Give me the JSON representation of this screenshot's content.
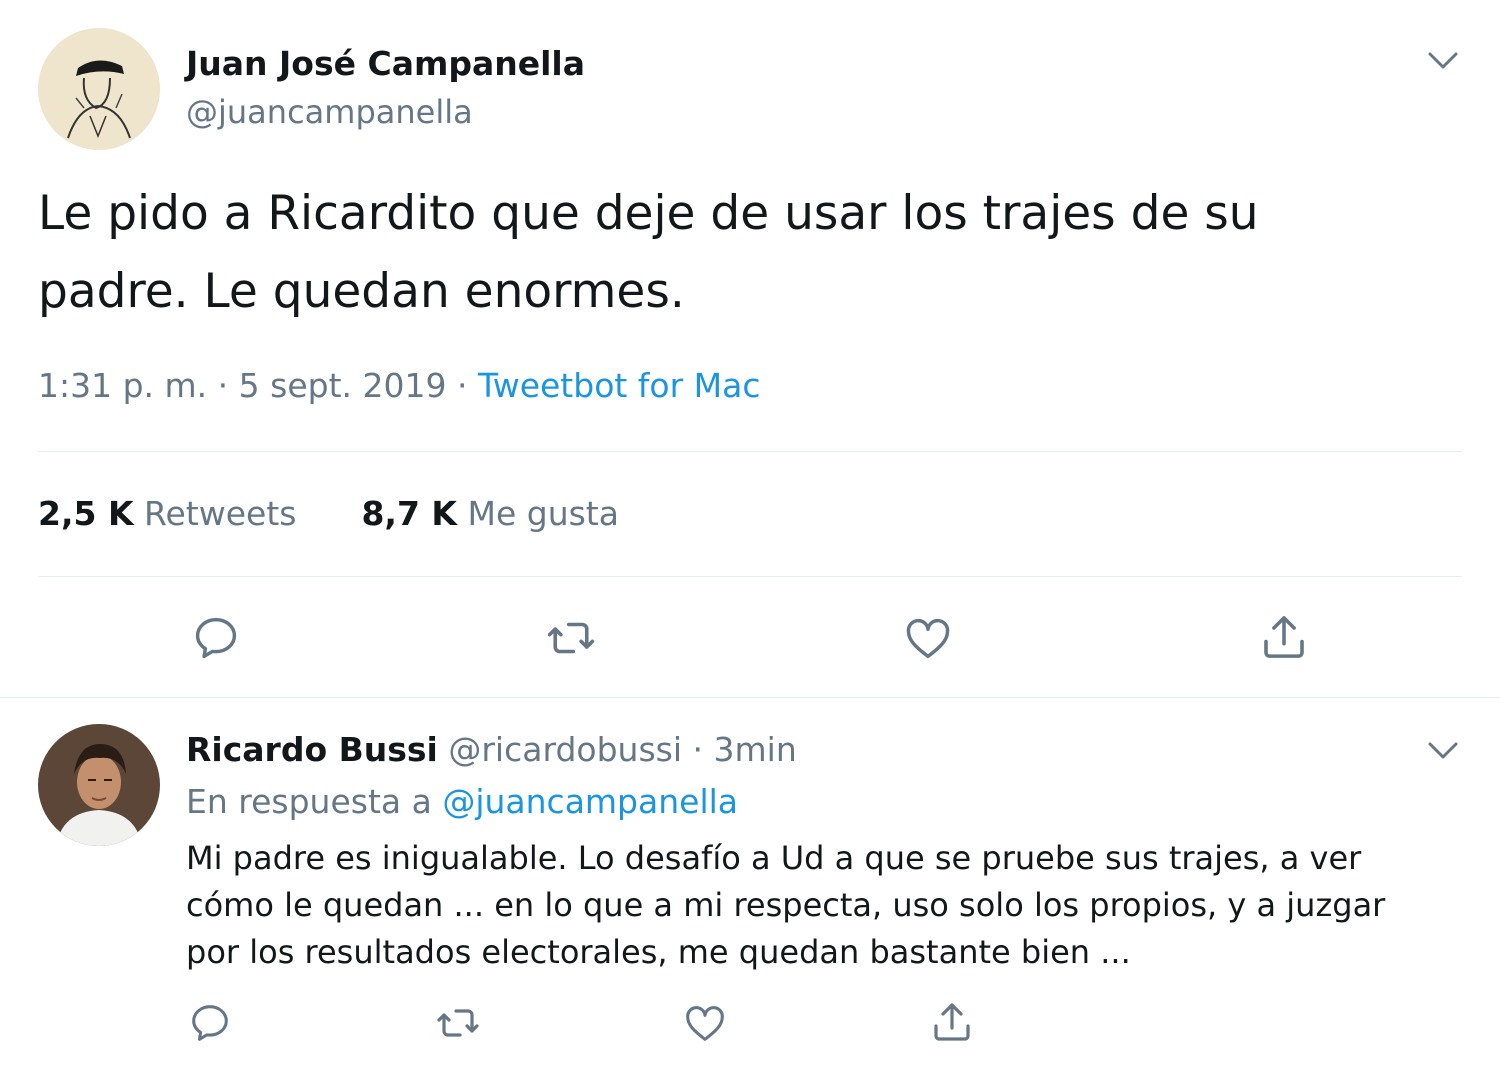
{
  "main_tweet": {
    "author_name": "Juan José Campanella",
    "author_handle": "@juancampanella",
    "text_line1": "Le pido a Ricardito que deje de usar los trajes de su",
    "text_line2": "padre. Le quedan enormes.",
    "time": "1:31 p. m.",
    "sep1": "·",
    "date": "5 sept. 2019",
    "sep2": "·",
    "source": "Tweetbot for Mac",
    "retweets_count": "2,5 K",
    "retweets_label": "Retweets",
    "likes_count": "8,7 K",
    "likes_label": "Me gusta"
  },
  "reply": {
    "author_name": "Ricardo Bussi",
    "author_handle": "@ricardobussi",
    "sep": "·",
    "time_ago": "3min",
    "reply_prefix": "En respuesta a",
    "reply_to": "@juancampanella",
    "text_line1": "Mi padre es inigualable. Lo desafío a Ud a que se pruebe sus trajes, a ver",
    "text_line2": "cómo le quedan ... en lo que a mi respecta, uso solo los propios, y a juzgar",
    "text_line3": "por los resultados electorales, me quedan bastante bien ..."
  },
  "icons": {
    "reply": "reply-icon",
    "retweet": "retweet-icon",
    "like": "heart-icon",
    "share": "share-icon",
    "menu": "chevron-down-icon"
  },
  "colors": {
    "link": "#1b95e0",
    "muted": "#657786",
    "text": "#14171a",
    "divider": "#e6ecf0"
  }
}
